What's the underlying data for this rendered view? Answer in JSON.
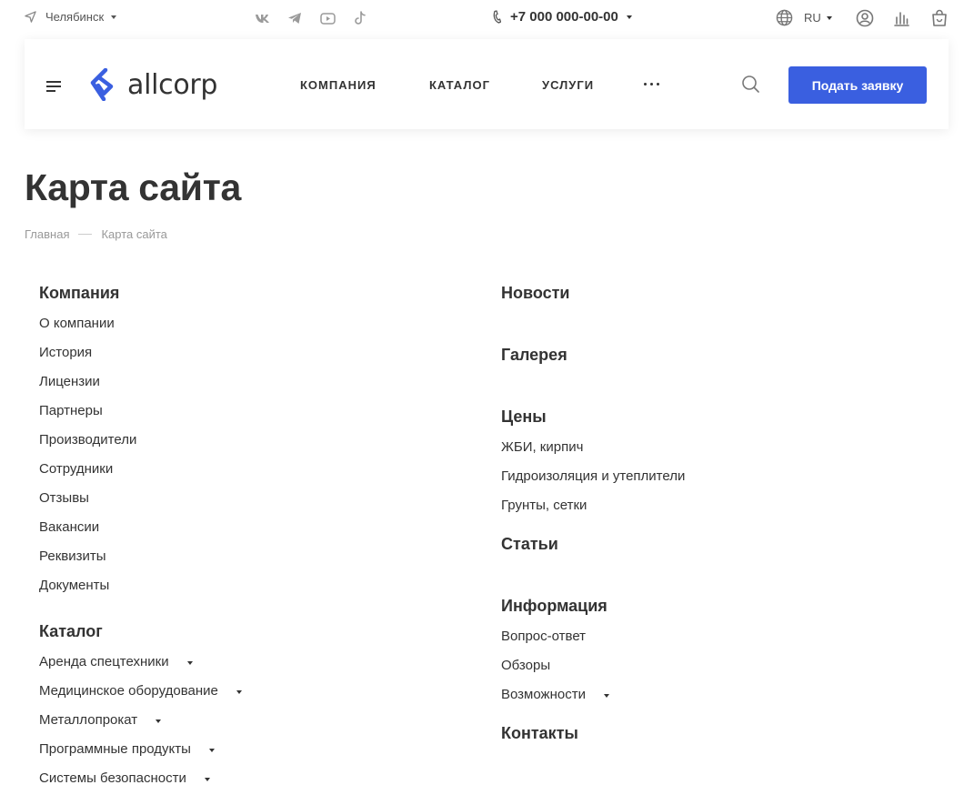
{
  "topbar": {
    "city": "Челябинск",
    "phone": "+7 000 000-00-00",
    "lang": "RU"
  },
  "header": {
    "logo_text": "allcorp",
    "nav": [
      "КОМПАНИЯ",
      "КАТАЛОГ",
      "УСЛУГИ"
    ],
    "cta_label": "Подать заявку"
  },
  "page": {
    "title": "Карта сайта",
    "breadcrumb": [
      "Главная",
      "Карта сайта"
    ]
  },
  "sitemap": {
    "company": {
      "title": "Компания",
      "items": [
        "О компании",
        "История",
        "Лицензии",
        "Партнеры",
        "Производители",
        "Сотрудники",
        "Отзывы",
        "Вакансии",
        "Реквизиты",
        "Документы"
      ]
    },
    "catalog": {
      "title": "Каталог",
      "items": [
        "Аренда спецтехники",
        "Медицинское оборудование",
        "Металлопрокат",
        "Программные продукты",
        "Системы безопасности"
      ]
    },
    "news": {
      "title": "Новости"
    },
    "gallery": {
      "title": "Галерея"
    },
    "prices": {
      "title": "Цены",
      "items": [
        "ЖБИ, кирпич",
        "Гидроизоляция и утеплители",
        "Грунты, сетки"
      ]
    },
    "articles": {
      "title": "Статьи"
    },
    "info": {
      "title": "Информация",
      "items": [
        "Вопрос-ответ",
        "Обзоры",
        "Возможности"
      ]
    },
    "contacts": {
      "title": "Контакты"
    }
  },
  "colors": {
    "accent": "#3a5fe0",
    "text": "#333333",
    "muted": "#999999"
  },
  "icons": [
    "location-arrow-icon",
    "vk-icon",
    "telegram-icon",
    "youtube-icon",
    "tiktok-icon",
    "phone-icon",
    "globe-icon",
    "profile-icon",
    "compare-icon",
    "cart-icon",
    "burger-icon",
    "search-icon",
    "logo-icon"
  ]
}
